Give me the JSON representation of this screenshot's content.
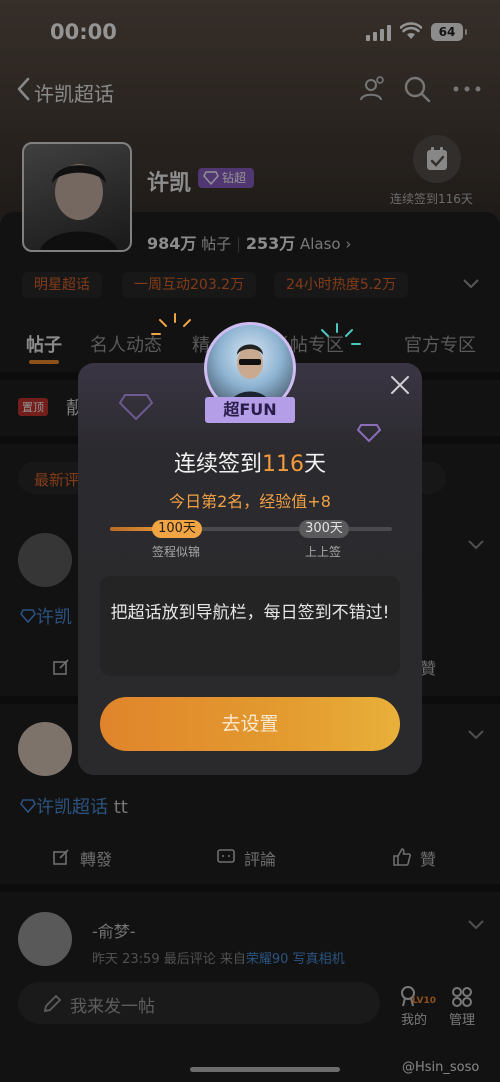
{
  "status_bar": {
    "time": "00:00",
    "battery": "64"
  },
  "nav": {
    "title": "许凯超话"
  },
  "profile": {
    "name": "许凯",
    "badge": "钻超",
    "checkin_text": "连续签到116天",
    "posts_count": "984万",
    "posts_label": "帖子",
    "alaso_count": "253万",
    "alaso_label": "Alaso",
    "tags": [
      "明星超话",
      "一周互动203.2万",
      "24小时热度5.2万"
    ]
  },
  "tabs": [
    "帖子",
    "名人动态",
    "精",
    "长帖专区",
    "官方专区"
  ],
  "pinned": {
    "badge": "置顶",
    "text": "靓"
  },
  "filter": {
    "label": "最新评"
  },
  "post1": {
    "topic": "许凯"
  },
  "post2": {
    "topic": "许凯超话",
    "text": "tt"
  },
  "actions": {
    "repost": "轉發",
    "comment": "評論",
    "like": "贊"
  },
  "commenter": {
    "name": "-俞梦-",
    "time": "昨天 23:59 最后评论",
    "from": "来自",
    "device": "荣耀90 写真相机"
  },
  "composer": {
    "placeholder": "我来发一帖"
  },
  "bottom": {
    "level": "LV10",
    "mine": "我的",
    "manage": "管理"
  },
  "watermark": "@Hsin_soso",
  "modal": {
    "ribbon": "超FUN",
    "title_prefix": "连续签到",
    "title_num": "116",
    "title_suffix": "天",
    "subtitle": "今日第2名，经验值+8",
    "progress_fraction": 0.25,
    "milestones": [
      {
        "value": "100天",
        "label": "签程似锦"
      },
      {
        "value": "300天",
        "label": "上上签"
      }
    ],
    "tip": "把超话放到导航栏，每日签到不错过!",
    "cta": "去设置"
  },
  "colors": {
    "accent": "#f28a2e",
    "link": "#4a90d9",
    "badge_purple": "#8a5fc4"
  }
}
